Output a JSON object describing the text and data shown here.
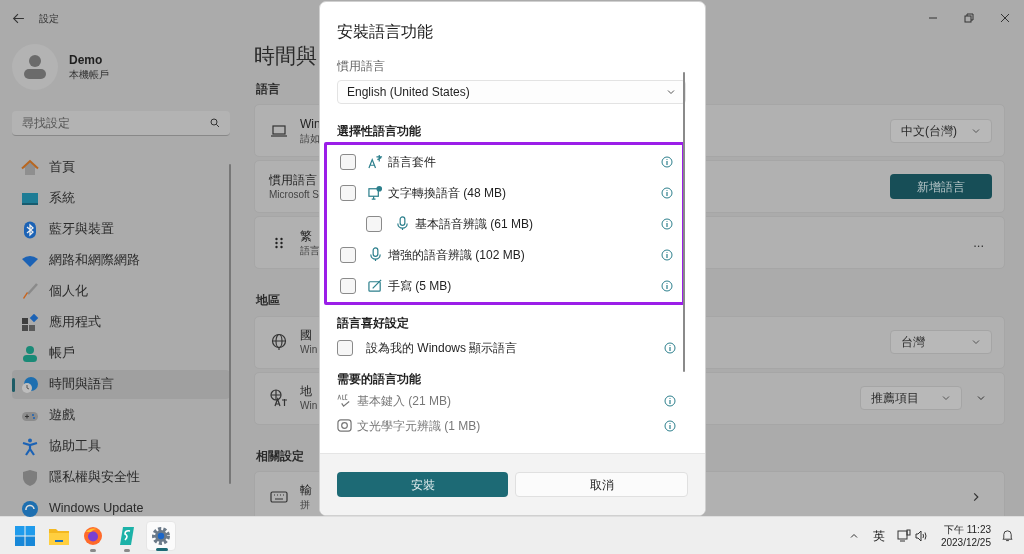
{
  "window": {
    "title": "設定"
  },
  "account": {
    "name": "Demo",
    "type": "本機帳戶"
  },
  "search": {
    "placeholder": "尋找設定"
  },
  "nav": [
    {
      "label": "首頁",
      "kind": "home",
      "selected": false
    },
    {
      "label": "系統",
      "kind": "system",
      "selected": false
    },
    {
      "label": "藍牙與裝置",
      "kind": "bluetooth",
      "selected": false
    },
    {
      "label": "網路和網際網路",
      "kind": "network",
      "selected": false
    },
    {
      "label": "個人化",
      "kind": "brush",
      "selected": false
    },
    {
      "label": "應用程式",
      "kind": "apps",
      "selected": false
    },
    {
      "label": "帳戶",
      "kind": "person",
      "selected": false
    },
    {
      "label": "時間與語言",
      "kind": "time",
      "selected": true
    },
    {
      "label": "遊戲",
      "kind": "gaming",
      "selected": false
    },
    {
      "label": "協助工具",
      "kind": "accessibility",
      "selected": false
    },
    {
      "label": "隱私權與安全性",
      "kind": "shield",
      "selected": false
    },
    {
      "label": "Windows Update",
      "kind": "update",
      "selected": false
    }
  ],
  "page": {
    "title": "時間與",
    "sections": [
      {
        "heading": "語言",
        "cards": [
          {
            "kind": "laptop",
            "title": "Win",
            "subtitle": "請如",
            "control": {
              "kind": "dropdown",
              "value": "中文(台灣)",
              "expandable": false
            }
          },
          {
            "kind": "plain",
            "title": "慣用語言",
            "subtitle": "Microsoft S",
            "control": {
              "kind": "button",
              "label": "新增語言"
            }
          },
          {
            "kind": "grip",
            "title": "繁",
            "subtitle": "語言",
            "control": {
              "kind": "more",
              "label": "..."
            }
          }
        ]
      },
      {
        "heading": "地區",
        "cards": [
          {
            "kind": "globe",
            "title": "國",
            "subtitle": "Win",
            "control": {
              "kind": "dropdown",
              "value": "台灣",
              "expandable": false
            }
          },
          {
            "kind": "translate",
            "title": "地",
            "subtitle": "Win",
            "control": {
              "kind": "dropdown",
              "value": "推薦項目",
              "expandable": true
            }
          }
        ]
      },
      {
        "heading": "相關設定",
        "cards": [
          {
            "kind": "keyboard",
            "title": "輸",
            "subtitle": "拼",
            "control": {
              "kind": "link"
            }
          }
        ]
      }
    ]
  },
  "dialog": {
    "title": "安裝語言功能",
    "preferred_label": "慣用語言",
    "preferred_value": "English (United States)",
    "optional_heading": "選擇性語言功能",
    "optional_features": [
      {
        "label": "語言套件",
        "kind": "language",
        "checked": false
      },
      {
        "label": "文字轉換語音 (48 MB)",
        "kind": "speech",
        "checked": false,
        "children": [
          {
            "label": "基本語音辨識 (61 MB)",
            "kind": "mic",
            "checked": false
          }
        ]
      },
      {
        "label": "增強的語音辨識 (102 MB)",
        "kind": "mic",
        "checked": false
      },
      {
        "label": "手寫 (5 MB)",
        "kind": "pen",
        "checked": false
      }
    ],
    "preferences_heading": "語言喜好設定",
    "preferences": [
      {
        "label": "設為我的 Windows 顯示語言",
        "checked": false
      }
    ],
    "required_heading": "需要的語言功能",
    "required_features": [
      {
        "label": "基本鍵入 (21 MB)",
        "kind": "abc",
        "disabled": true
      },
      {
        "label": "文光學字元辨識 (1 MB)",
        "kind": "scan",
        "disabled": true
      }
    ],
    "buttons": [
      {
        "label": "安裝",
        "kind": "primary"
      },
      {
        "label": "取消",
        "kind": "secondary"
      }
    ]
  },
  "taskbar": {
    "apps": [
      {
        "kind": "start",
        "running": false,
        "selected": false
      },
      {
        "kind": "folder",
        "running": false,
        "selected": false
      },
      {
        "kind": "browser",
        "running": true,
        "selected": false
      },
      {
        "kind": "s_app",
        "running": true,
        "selected": false
      },
      {
        "kind": "settings",
        "running": true,
        "selected": true
      }
    ],
    "ime": "英",
    "time": "下午 11:23",
    "date": "2023/12/25"
  }
}
